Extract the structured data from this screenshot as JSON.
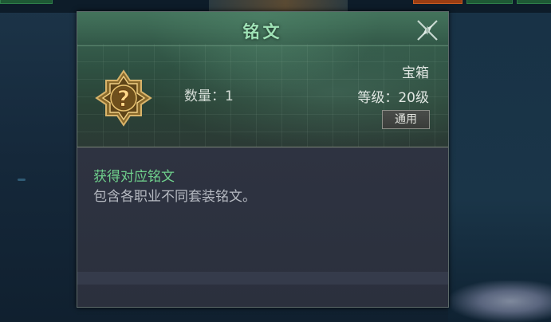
{
  "dialog": {
    "title": "铭文",
    "item": {
      "icon": "mystery-chest-icon",
      "quantity_label": "数量：1",
      "type": "宝箱",
      "level_label": "等级：20级",
      "tag": "通用"
    },
    "description": {
      "title": "获得对应铭文",
      "text": "包含各职业不同套装铭文。"
    }
  },
  "colors": {
    "title": "#9fe2b6",
    "desc_title": "#6fd08c",
    "desc_text": "#b6bac2"
  }
}
